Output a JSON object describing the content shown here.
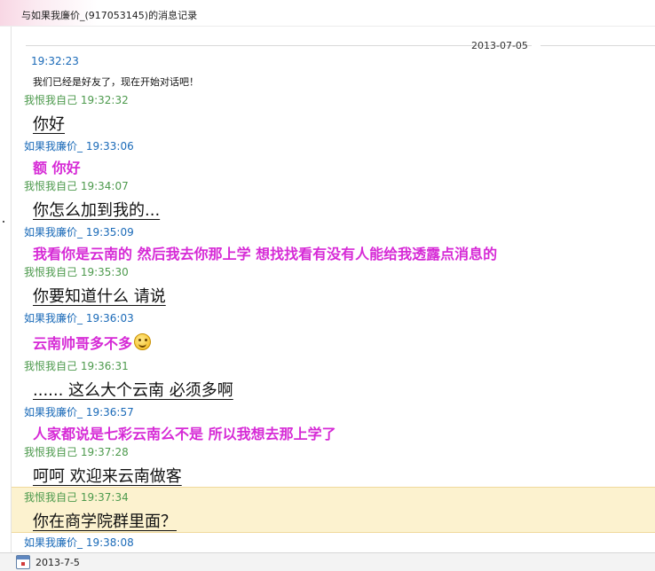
{
  "window": {
    "title": "与如果我廉价_(917053145)的消息记录"
  },
  "history": {
    "date_divider": "2013-07-05",
    "messages": [
      {
        "kind": "system",
        "time": "19:32:23",
        "text": "我们已经是好友了，现在开始对话吧！"
      },
      {
        "kind": "me",
        "header": "我恨我自己 19:32:32",
        "text": "你好 "
      },
      {
        "kind": "them",
        "header": "如果我廉价_ 19:33:06",
        "text": "额 你好"
      },
      {
        "kind": "me",
        "header": "我恨我自己 19:34:07",
        "text": "你怎么加到我的..."
      },
      {
        "kind": "them",
        "header": "如果我廉价_ 19:35:09",
        "text": "我看你是云南的 然后我去你那上学 想找找看有没有人能给我透露点消息的"
      },
      {
        "kind": "me",
        "header": "我恨我自己 19:35:30",
        "text": "你要知道什么  请说"
      },
      {
        "kind": "them",
        "header": "如果我廉价_ 19:36:03",
        "text": "云南帅哥多不多",
        "emoticon": "smiley-icon"
      },
      {
        "kind": "me",
        "header": "我恨我自己 19:36:31",
        "text": "......    这么大个云南  必须多啊"
      },
      {
        "kind": "them",
        "header": "如果我廉价_ 19:36:57",
        "text": "人家都说是七彩云南么不是 所以我想去那上学了"
      },
      {
        "kind": "me",
        "header": "我恨我自己 19:37:28",
        "text": "呵呵  欢迎来云南做客"
      },
      {
        "kind": "me",
        "header": "我恨我自己 19:37:34",
        "text": "你在商学院群里面？",
        "highlighted": true
      },
      {
        "kind": "them",
        "header": "如果我廉价_ 19:38:08",
        "text": ""
      }
    ]
  },
  "status_bar": {
    "date": "2013-7-5",
    "icon": "calendar-icon"
  },
  "colors": {
    "them_name": "#1a6ab8",
    "me_name": "#4d9a4d",
    "them_text": "#d62ad6",
    "highlight_bg": "#fcf2cf"
  }
}
